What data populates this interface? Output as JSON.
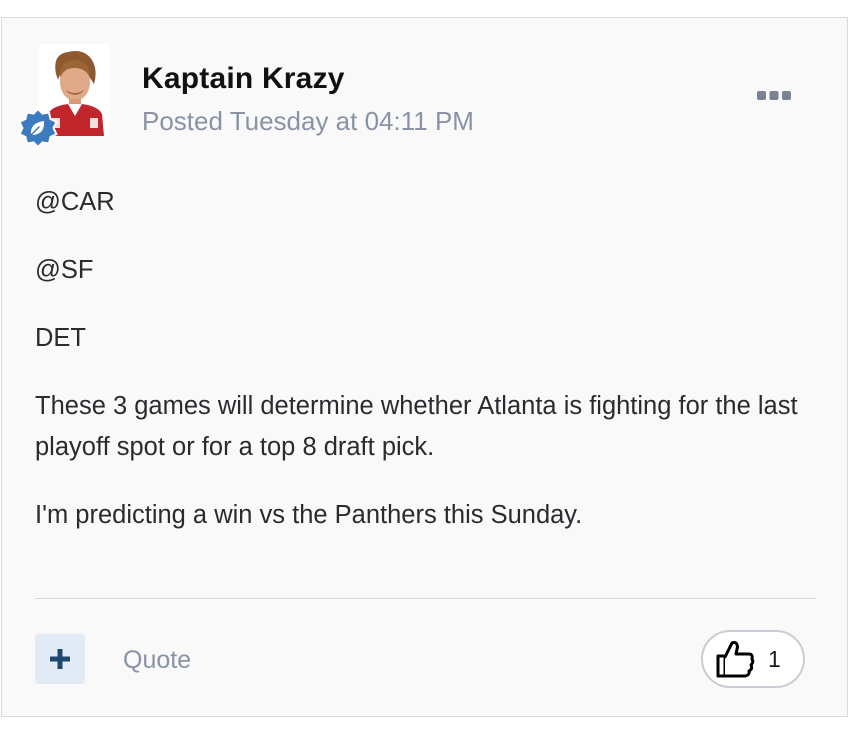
{
  "post": {
    "author": "Kaptain Krazy",
    "posted": "Posted Tuesday at 04:11 PM",
    "body": [
      "@CAR",
      "@SF",
      "DET",
      "These 3 games will determine whether Atlanta is fighting for the last playoff spot or for a top 8 draft pick.",
      "I'm predicting a win vs the Panthers this Sunday."
    ]
  },
  "icons": {
    "avatar": "user-avatar",
    "badge": "leaf-badge-icon",
    "menu": "more-options-icon",
    "add": "plus-icon",
    "like": "thumbs-up-icon"
  },
  "actions": {
    "quote_label": "Quote",
    "like_count": "1"
  },
  "colors": {
    "card_background": "#f9f9fa",
    "meta_text": "#8a93a5",
    "badge": "#3d7bbf",
    "plus_button_bg": "#e2ebf5",
    "plus_icon": "#1f4770"
  }
}
